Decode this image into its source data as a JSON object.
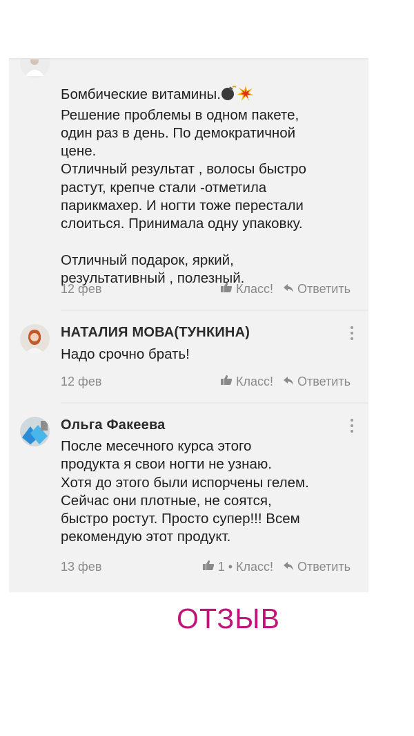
{
  "comments": [
    {
      "name": "",
      "text_line1": "Бомбические витамины.",
      "text_rest": "Решение проблемы в одном пакете,\nодин раз в день. По демократичной\nцене.\nОтличный результат , волосы быстро\nрастут, крепче стали -отметила\nпарикмахер. И ногти тоже   перестали\nслоиться. Принимала одну упаковку.\n\nОтличный подарок, яркий,\nрезультативный , полезный.",
      "date": "12 фев",
      "like_label": "Класс!",
      "reply_label": "Ответить",
      "emoji": [
        "bomb-icon",
        "collision-icon"
      ]
    },
    {
      "name": "НАТАЛИЯ МОВА(ТУНКИНА)",
      "text": "Надо срочно брать!",
      "date": "12 фев",
      "like_label": "Класс!",
      "reply_label": "Ответить"
    },
    {
      "name": "Ольга Факеева",
      "text": "После месечного курса этого\nпродукта я свои ногти не узнаю.\nХотя до этого были испорчены гелем.\nСейчас они плотные, не соятся,\nбыстро ростут. Просто супер!!! Всем\nрекомендую этот продукт.",
      "date": "13 фев",
      "like_count": "1",
      "like_separator": "•",
      "like_label": "Класс!",
      "reply_label": "Ответить"
    }
  ],
  "footer": {
    "label": "ОТЗЫВ"
  },
  "colors": {
    "accent": "#c0147a",
    "card_bg": "#f2f2f2",
    "muted": "#8a8a8a"
  }
}
